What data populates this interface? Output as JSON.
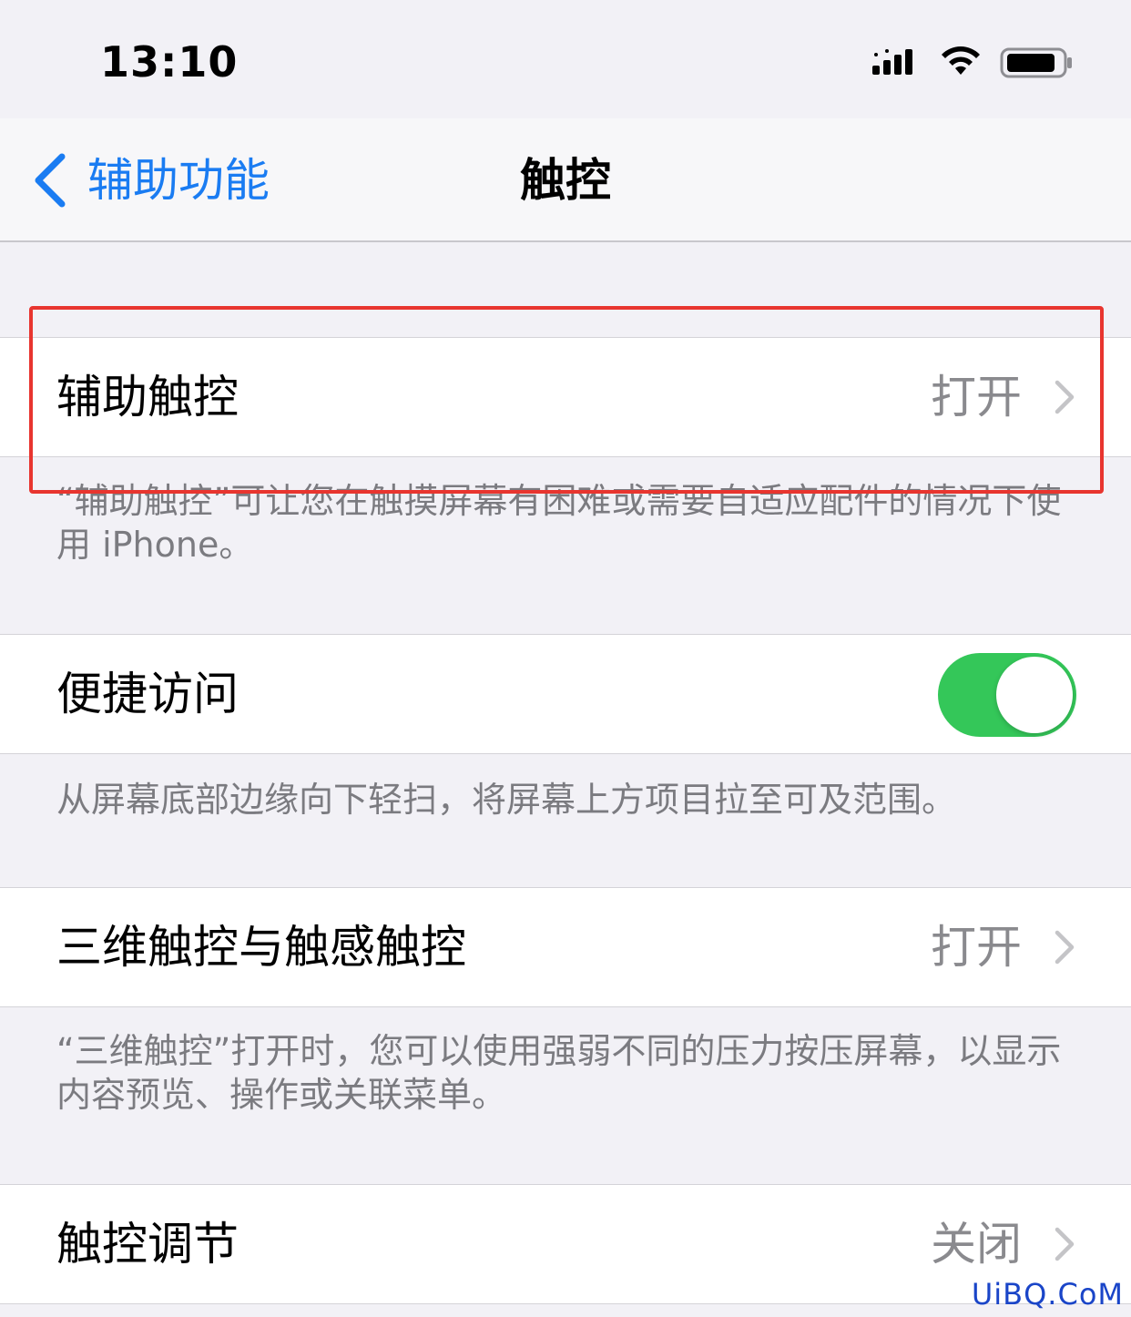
{
  "status_bar": {
    "time": "13:10",
    "signal_icon": "cellular-signal-icon",
    "wifi_icon": "wifi-icon",
    "battery_icon": "battery-icon"
  },
  "nav": {
    "back_label": "辅助功能",
    "title": "触控",
    "accent_color": "#1a7cf2"
  },
  "sections": {
    "assistive_touch": {
      "label": "辅助触控",
      "value": "打开",
      "footer": "“辅助触控”可让您在触摸屏幕有困难或需要自适应配件的情况下使用 iPhone。"
    },
    "reachability": {
      "label": "便捷访问",
      "toggle_on": true,
      "toggle_color": "#34c759",
      "footer": "从屏幕底部边缘向下轻扫，将屏幕上方项目拉至可及范围。"
    },
    "touch_3d": {
      "label": "三维触控与触感触控",
      "value": "打开",
      "footer": "“三维触控”打开时，您可以使用强弱不同的压力按压屏幕，以显示内容预览、操作或关联菜单。"
    },
    "touch_accommodations": {
      "label": "触控调节",
      "value": "关闭"
    }
  },
  "annotation_color": "#e8352f",
  "watermark": "UiBQ.CoM"
}
